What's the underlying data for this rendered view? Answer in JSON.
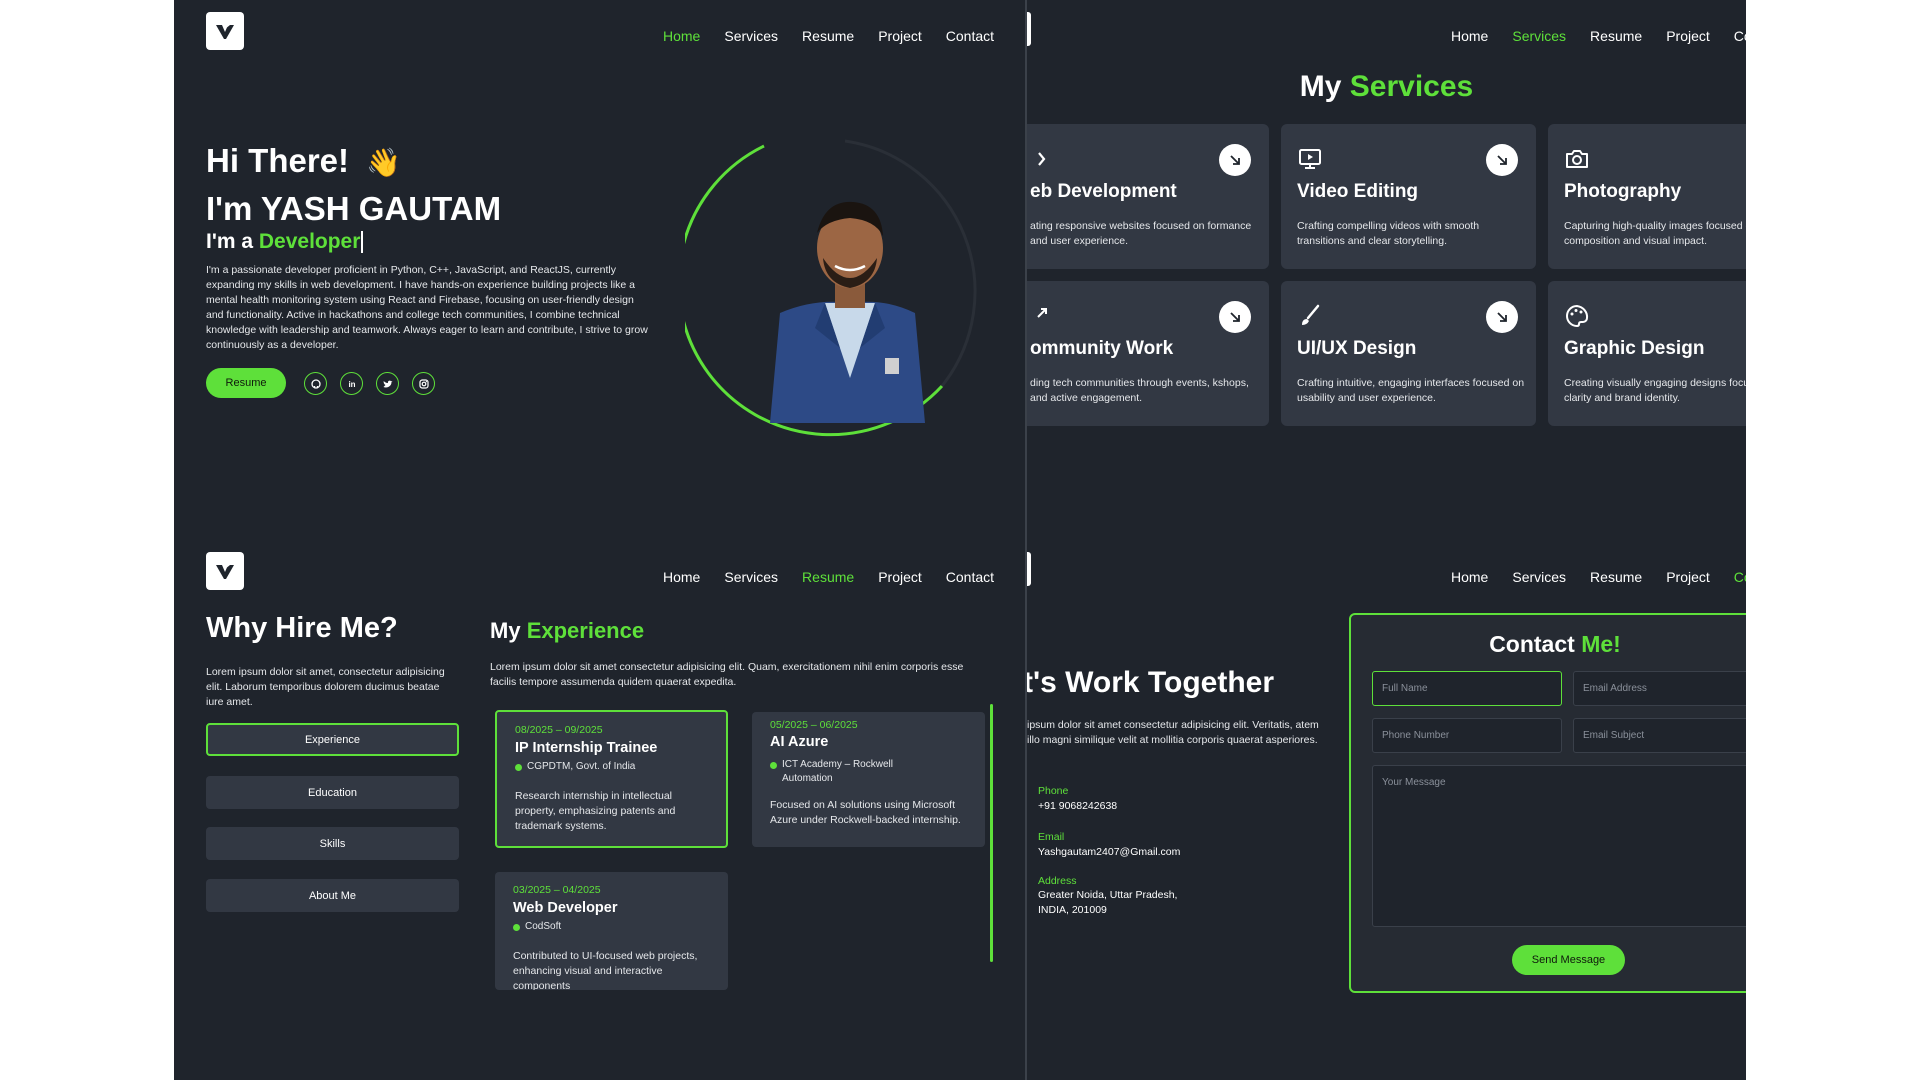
{
  "nav": {
    "items": [
      "Home",
      "Services",
      "Resume",
      "Project",
      "Contact"
    ],
    "items_cut": [
      "Home",
      "Services",
      "Resume",
      "Project",
      "Co"
    ]
  },
  "hero": {
    "greeting": "Hi There!",
    "wave": "👋",
    "name": "I'm YASH GAUTAM",
    "role_prefix": "I'm a ",
    "role": "Developer",
    "bio": "I'm a passionate developer proficient in Python, C++, JavaScript, and ReactJS, currently expanding my skills in web development. I have hands-on experience building projects like a mental health monitoring system using React and Firebase, focusing on user-friendly design and functionality. Active in hackathons and college tech communities, I combine technical knowledge with leadership and teamwork. Always eager to learn and contribute, I strive to grow continuously as a developer.",
    "resume_button": "Resume",
    "socials": [
      "github-icon",
      "linkedin-icon",
      "twitter-icon",
      "instagram-icon"
    ]
  },
  "services": {
    "title_a": "My ",
    "title_b": "Services",
    "cards": [
      {
        "title": "eb Development",
        "desc": "ating responsive websites focused on formance and user experience.",
        "icon": "code-icon"
      },
      {
        "title": "Video Editing",
        "desc": "Crafting compelling videos with smooth transitions and clear storytelling.",
        "icon": "monitor-icon"
      },
      {
        "title": "Photography",
        "desc": "Capturing high-quality images focused o composition and visual impact.",
        "icon": "camera-icon"
      },
      {
        "title": "ommunity Work",
        "desc": "ding tech communities through events, kshops, and active engagement.",
        "icon": "arrow-up-right-icon"
      },
      {
        "title": "UI/UX Design",
        "desc": "Crafting intuitive, engaging interfaces focused on usability and user experience.",
        "icon": "brush-icon"
      },
      {
        "title": "Graphic Design",
        "desc": "Creating visually engaging designs focus on clarity and brand identity.",
        "icon": "palette-icon"
      }
    ]
  },
  "resume": {
    "why_title": "Why Hire Me?",
    "why_text": "Lorem ipsum dolor sit amet, consectetur adipisicing elit. Laborum temporibus dolorem ducimus beatae iure amet.",
    "tabs": [
      "Experience",
      "Education",
      "Skills",
      "About Me"
    ],
    "exp_title_a": "My ",
    "exp_title_b": "Experience",
    "exp_text": "Lorem ipsum dolor sit amet consectetur adipisicing elit. Quam, exercitationem nihil enim corporis esse facilis tempore assumenda quidem quaerat expedita.",
    "experience": [
      {
        "date": "08/2025 – 09/2025",
        "title": "IP Internship Trainee",
        "org": "CGPDTM, Govt. of India",
        "desc": "Research internship in intellectual property, emphasizing patents and trademark systems."
      },
      {
        "date": "05/2025 – 06/2025",
        "title": "AI Azure",
        "org": "ICT Academy – Rockwell Automation",
        "desc": "Focused on AI solutions using Microsoft Azure under Rockwell-backed internship."
      },
      {
        "date": "03/2025 – 04/2025",
        "title": "Web Developer",
        "org": "CodSoft",
        "desc": "Contributed to UI-focused web projects, enhancing visual and interactive components"
      }
    ]
  },
  "contact": {
    "heading": "t's Work Together",
    "text": "ipsum dolor sit amet consectetur adipisicing elit. Veritatis, atem illo magni similique velit at mollitia corporis quaerat asperiores.",
    "phone_label": "Phone",
    "phone": "+91 9068242638",
    "email_label": "Email",
    "email": "Yashgautam2407@Gmail.com",
    "address_label": "Address",
    "address_1": "Greater Noida, Uttar Pradesh,",
    "address_2": "INDIA, 201009",
    "form_title_a": "Contact ",
    "form_title_b": "Me!",
    "ph_name": "Full Name",
    "ph_email": "Email Address",
    "ph_phone": "Phone Number",
    "ph_subject": "Email Subject",
    "ph_message": "Your Message",
    "send": "Send Message"
  },
  "colors": {
    "accent": "#5ee03a",
    "background": "#1f242c",
    "card": "#323843"
  }
}
